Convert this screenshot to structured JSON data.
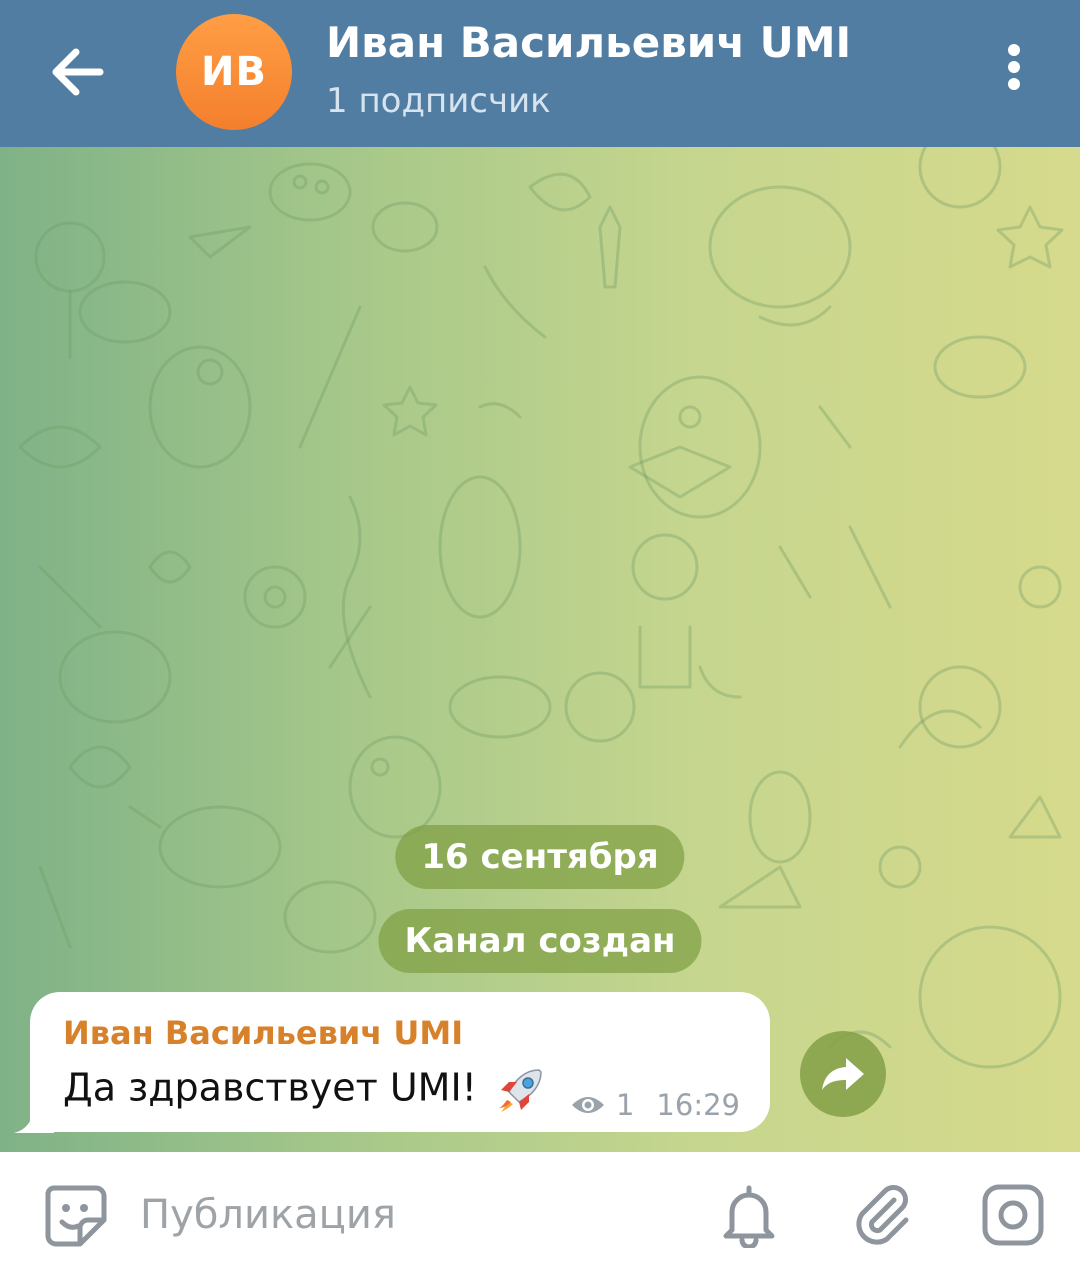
{
  "header": {
    "avatar_initials": "ИВ",
    "title": "Иван Васильевич UMI",
    "subtitle": "1 подписчик"
  },
  "chat": {
    "date_label": "16 сентября",
    "service_message": "Канал создан",
    "message": {
      "author": "Иван Васильевич UMI",
      "text": "Да здравствует UMI!",
      "views": "1",
      "time": "16:29"
    }
  },
  "composer": {
    "placeholder": "Публикация"
  },
  "icons": {
    "back": "arrow-left-icon",
    "menu": "more-vertical-icon",
    "emoji": "sticker-icon",
    "bell": "bell-icon",
    "attach": "paperclip-icon",
    "camera": "camera-icon",
    "share": "share-icon",
    "views": "eye-icon",
    "rocket": "rocket-emoji"
  },
  "colors": {
    "header": "#517da2",
    "avatar": "#f58a35",
    "author": "#d7822a",
    "pill": "#82a046"
  }
}
